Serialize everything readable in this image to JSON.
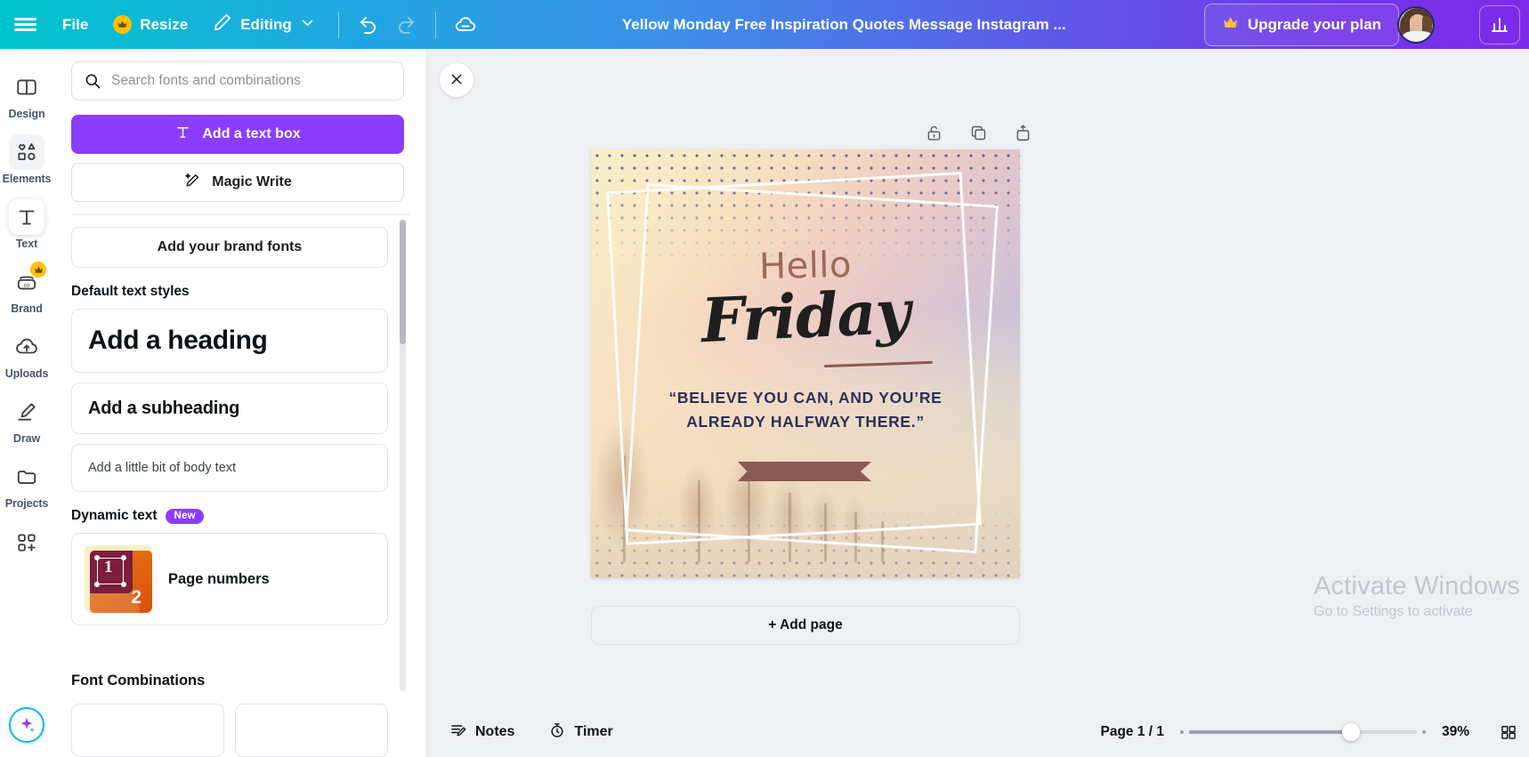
{
  "topbar": {
    "menu_icon": "hamburger-icon",
    "file_label": "File",
    "resize_label": "Resize",
    "resize_icon": "crown-icon",
    "editing_label": "Editing",
    "editing_icon": "pencil-icon",
    "chevron_icon": "chevron-down-icon",
    "undo_icon": "undo-icon",
    "redo_icon": "redo-icon",
    "cloud_icon": "cloud-sync-icon",
    "title": "Yellow Monday Free Inspiration Quotes Message Instagram ...",
    "upgrade_label": "Upgrade your plan",
    "upgrade_icon": "crown-icon",
    "avatar_name": "user-avatar",
    "add_member_icon": "plus-icon",
    "insights_icon": "bar-chart-icon",
    "gradient_start": "#00c4cc",
    "gradient_end": "#7d2ae8"
  },
  "rail": {
    "items": [
      {
        "label": "Design",
        "icon": "layout-icon"
      },
      {
        "label": "Elements",
        "icon": "shapes-icon"
      },
      {
        "label": "Text",
        "icon": "text-t-icon"
      },
      {
        "label": "Brand",
        "icon": "brand-icon",
        "badge": "crown-icon"
      },
      {
        "label": "Uploads",
        "icon": "cloud-upload-icon"
      },
      {
        "label": "Draw",
        "icon": "pen-icon"
      },
      {
        "label": "Projects",
        "icon": "folder-icon"
      },
      {
        "label": "",
        "icon": "apps-plus-icon"
      }
    ],
    "active_index": 2,
    "magic_icon": "magic-sparkle-icon"
  },
  "panel": {
    "search": {
      "placeholder": "Search fonts and combinations",
      "value": "",
      "icon": "search-icon"
    },
    "add_text_box": {
      "label": "Add a text box",
      "icon": "text-t-icon"
    },
    "magic_write": {
      "label": "Magic Write",
      "icon": "magic-pencil-icon"
    },
    "brand_fonts": {
      "label": "Add your brand fonts"
    },
    "default_styles_title": "Default text styles",
    "styles": [
      {
        "label": "Add a heading",
        "kind": "heading"
      },
      {
        "label": "Add a subheading",
        "kind": "subheading"
      },
      {
        "label": "Add a little bit of body text",
        "kind": "body"
      }
    ],
    "dynamic_text_title": "Dynamic text",
    "dynamic_text_badge": "New",
    "dynamic_items": [
      {
        "label": "Page numbers",
        "thumb_num1": "1",
        "thumb_num2": "2"
      }
    ],
    "font_combinations_title": "Font Combinations"
  },
  "editor": {
    "close_icon": "close-icon",
    "canvas_tools": [
      {
        "name": "unlock-icon"
      },
      {
        "name": "duplicate-icon"
      },
      {
        "name": "add-page-after-icon"
      }
    ],
    "add_page_label": "+ Add page",
    "watermark": {
      "line1": "Activate Windows",
      "line2": "Go to Settings to activate"
    }
  },
  "design": {
    "hello_text": "Hello",
    "script_text": "Friday",
    "quote_line1": "“BELIEVE YOU CAN, AND YOU’RE",
    "quote_line2": "ALREADY HALFWAY THERE.”",
    "quote_color": "#2b3157",
    "hello_color": "#9a6b5b",
    "banner_color": "#8a5a54"
  },
  "bottombar": {
    "notes_label": "Notes",
    "notes_icon": "notes-icon",
    "timer_label": "Timer",
    "timer_icon": "timer-icon",
    "page_label": "Page 1 / 1",
    "zoom_label": "39%",
    "zoom_value": 39,
    "grid_icon": "grid-view-icon"
  }
}
